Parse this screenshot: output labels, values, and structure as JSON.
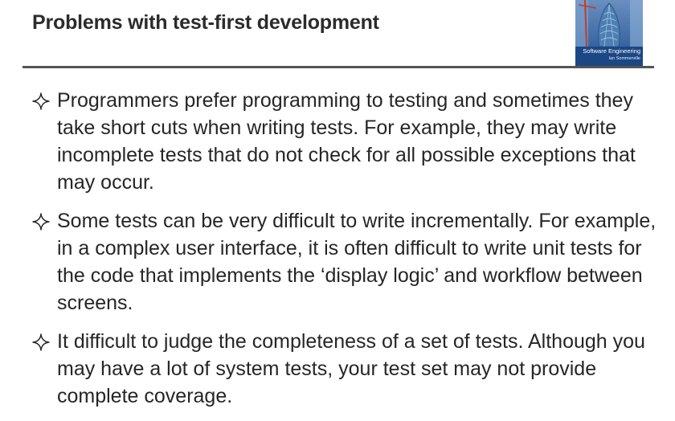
{
  "slide": {
    "title": "Problems with test-first development",
    "book_cover": {
      "title": "Software Engineering",
      "author": "Ian Sommerville",
      "icon": "book-cover-image"
    },
    "bullet_icon": "four-point-star-outline",
    "bullets": [
      "Programmers prefer programming to testing and sometimes they take short cuts when writing tests. For example, they may write incomplete tests that do not check for all possible exceptions that may occur.",
      "Some tests can be very difficult to write incrementally. For example, in a complex user interface, it is often difficult to write unit tests for the code that implements the ‘display logic’ and workflow between screens.",
      "It difficult to judge the completeness of a set of tests. Although you may have a lot of system tests, your test set may not provide complete coverage."
    ]
  }
}
